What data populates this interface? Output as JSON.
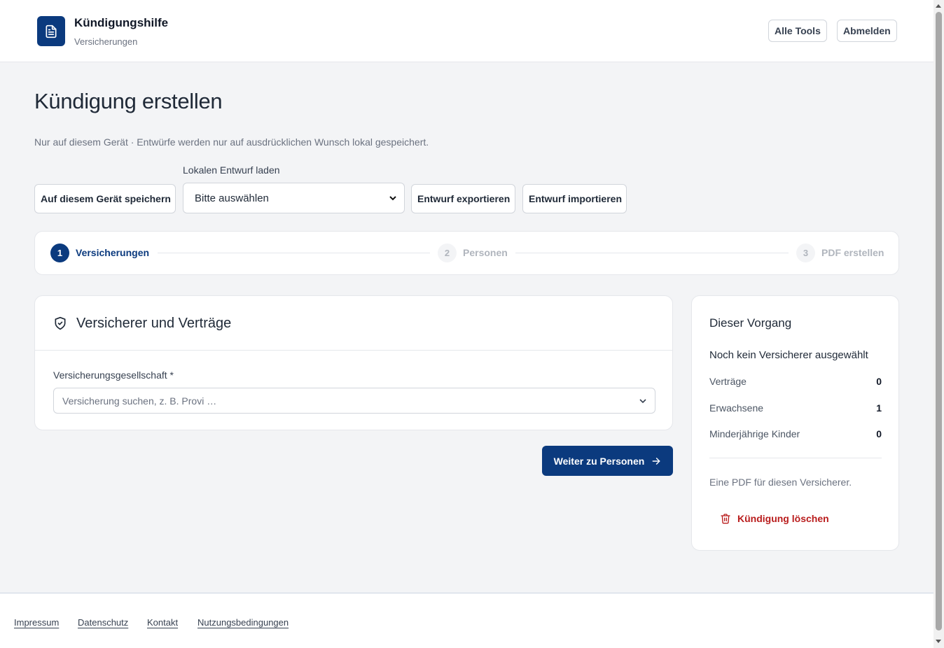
{
  "header": {
    "title": "Kündigungshilfe",
    "subtitle": "Versicherungen",
    "logo_icon": "document-icon",
    "buttons": {
      "all_tools": "Alle Tools",
      "logout": "Abmelden"
    }
  },
  "page": {
    "title": "Kündigung erstellen",
    "note": "Nur auf diesem Gerät · Entwürfe werden nur auf ausdrücklichen Wunsch lokal gespeichert."
  },
  "draft_tools": {
    "save_label": "Auf diesem Gerät speichern",
    "load_label": "Lokalen Entwurf laden",
    "load_selected": "Bitte auswählen",
    "export_label": "Entwurf exportieren",
    "import_label": "Entwurf importieren"
  },
  "stepper": {
    "steps": [
      {
        "number": "1",
        "label": "Versicherungen",
        "active": true
      },
      {
        "number": "2",
        "label": "Personen",
        "active": false
      },
      {
        "number": "3",
        "label": "PDF erstellen",
        "active": false
      }
    ]
  },
  "insurer_card": {
    "title": "Versicherer und Verträge",
    "icon": "shield-check-icon",
    "field_label": "Versicherungsgesellschaft *",
    "field_placeholder": "Versicherung suchen, z. B. Provi …"
  },
  "next_button": {
    "label": "Weiter zu Personen",
    "icon": "arrow-right-icon"
  },
  "summary": {
    "title": "Dieser Vorgang",
    "status": "Noch kein Versicherer ausgewählt",
    "stats": [
      {
        "label": "Verträge",
        "value": "0"
      },
      {
        "label": "Erwachsene",
        "value": "1"
      },
      {
        "label": "Minderjährige Kinder",
        "value": "0"
      }
    ],
    "note": "Eine PDF für diesen Versicherer.",
    "delete_label": "Kündigung löschen",
    "delete_icon": "trash-icon"
  },
  "footer": {
    "links": [
      "Impressum",
      "Datenschutz",
      "Kontakt",
      "Nutzungsbedingungen"
    ]
  },
  "colors": {
    "primary": "#0b3a7e",
    "danger": "#b91c1c",
    "background": "#f3f4f6"
  }
}
